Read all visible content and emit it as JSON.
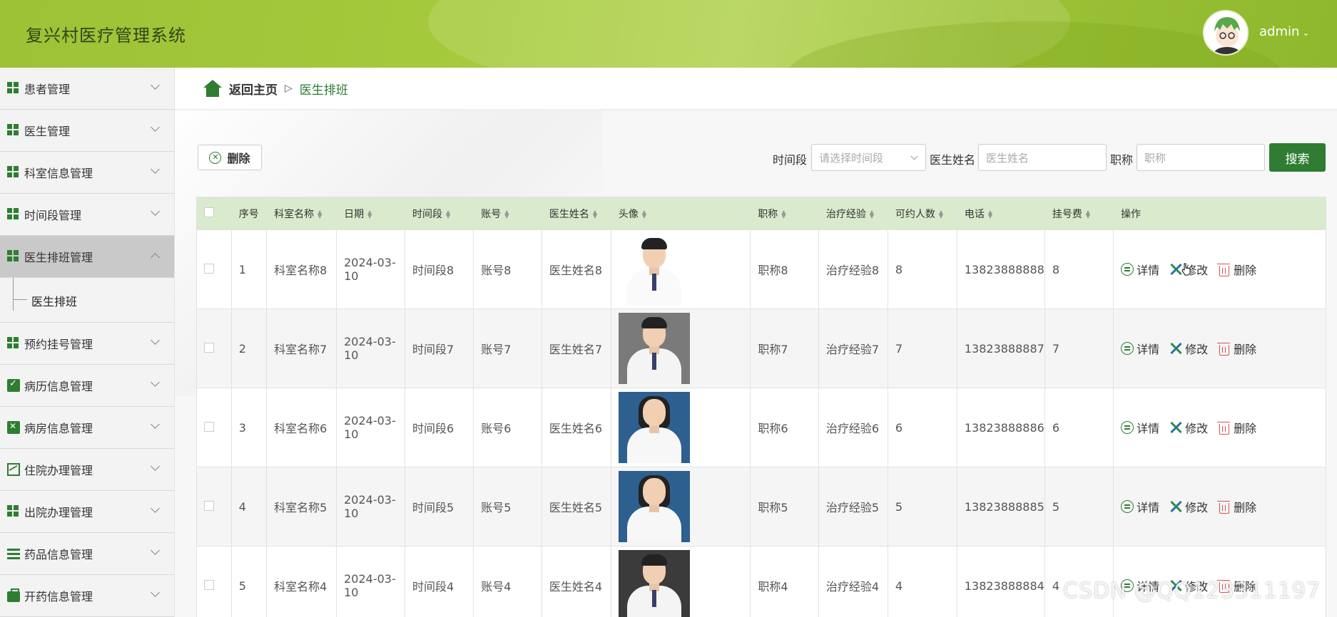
{
  "header": {
    "title": "复兴村医疗管理系统",
    "user": "admin"
  },
  "sidebar": {
    "items": [
      {
        "label": "患者管理",
        "icon": "grid-icon"
      },
      {
        "label": "医生管理",
        "icon": "grid-icon"
      },
      {
        "label": "科室信息管理",
        "icon": "grid-icon"
      },
      {
        "label": "时间段管理",
        "icon": "grid-icon"
      },
      {
        "label": "医生排班管理",
        "icon": "grid-icon",
        "active": true,
        "sub": "医生排班"
      },
      {
        "label": "预约挂号管理",
        "icon": "grid-icon"
      },
      {
        "label": "病历信息管理",
        "icon": "clipboard-icon"
      },
      {
        "label": "病房信息管理",
        "icon": "clipboard-x-icon"
      },
      {
        "label": "住院办理管理",
        "icon": "chart-icon"
      },
      {
        "label": "出院办理管理",
        "icon": "grid-icon"
      },
      {
        "label": "药品信息管理",
        "icon": "list-icon"
      },
      {
        "label": "开药信息管理",
        "icon": "briefcase-icon"
      }
    ]
  },
  "breadcrumb": {
    "home": "返回主页",
    "sep": "▷",
    "current": "医生排班"
  },
  "toolbar": {
    "delete_label": "删除"
  },
  "search": {
    "time_label": "时间段",
    "time_placeholder": "请选择时间段",
    "name_label": "医生姓名",
    "name_placeholder": "医生姓名",
    "title_label": "职称",
    "title_placeholder": "职称",
    "button": "搜索"
  },
  "table": {
    "headers": [
      "序号",
      "科室名称",
      "日期",
      "时间段",
      "账号",
      "医生姓名",
      "头像",
      "职称",
      "治疗经验",
      "可约人数",
      "电话",
      "挂号费",
      "操作"
    ],
    "actions": {
      "detail": "详情",
      "edit": "修改",
      "delete": "删除"
    },
    "rows": [
      {
        "no": "1",
        "dept": "科室名称8",
        "date": "2024-03-10",
        "slot": "时间段8",
        "account": "账号8",
        "name": "医生姓名8",
        "title": "职称8",
        "exp": "治疗经验8",
        "quota": "8",
        "phone": "13823888888",
        "fee": "8"
      },
      {
        "no": "2",
        "dept": "科室名称7",
        "date": "2024-03-10",
        "slot": "时间段7",
        "account": "账号7",
        "name": "医生姓名7",
        "title": "职称7",
        "exp": "治疗经验7",
        "quota": "7",
        "phone": "13823888887",
        "fee": "7"
      },
      {
        "no": "3",
        "dept": "科室名称6",
        "date": "2024-03-10",
        "slot": "时间段6",
        "account": "账号6",
        "name": "医生姓名6",
        "title": "职称6",
        "exp": "治疗经验6",
        "quota": "6",
        "phone": "13823888886",
        "fee": "6"
      },
      {
        "no": "4",
        "dept": "科室名称5",
        "date": "2024-03-10",
        "slot": "时间段5",
        "account": "账号5",
        "name": "医生姓名5",
        "title": "职称5",
        "exp": "治疗经验5",
        "quota": "5",
        "phone": "13823888885",
        "fee": "5"
      },
      {
        "no": "5",
        "dept": "科室名称4",
        "date": "2024-03-10",
        "slot": "时间段4",
        "account": "账号4",
        "name": "医生姓名4",
        "title": "职称4",
        "exp": "治疗经验4",
        "quota": "4",
        "phone": "13823888884",
        "fee": "4"
      }
    ]
  },
  "watermark": "CSDN @QQ123311197",
  "colors": {
    "primary": "#2e7d32",
    "header": "#a5ca3c",
    "table_header": "#d9ebcc",
    "danger": "#d9534f"
  }
}
